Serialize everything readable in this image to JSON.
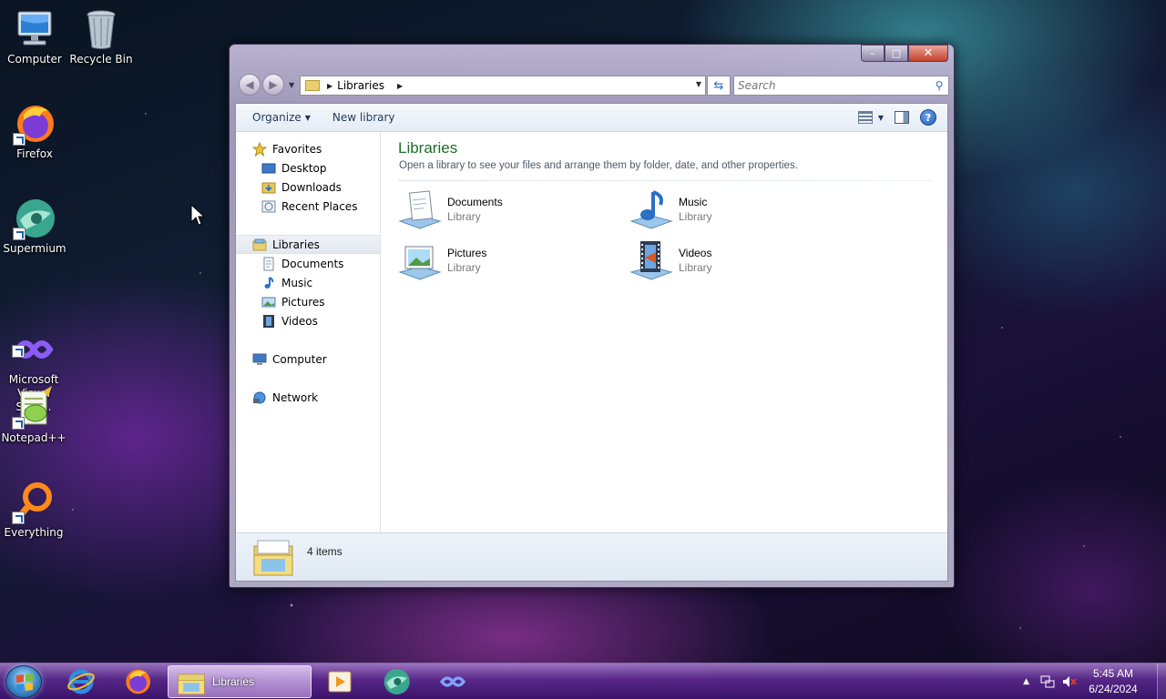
{
  "desktop": {
    "icons": [
      {
        "label": "Computer"
      },
      {
        "label": "Recycle Bin"
      },
      {
        "label": "Firefox"
      },
      {
        "label": "Supermium"
      },
      {
        "label": "Microsoft\nVisual Stud..."
      },
      {
        "label": "Notepad++"
      },
      {
        "label": "Everything"
      }
    ]
  },
  "window": {
    "caption": {
      "minimize": "–",
      "maximize": "□",
      "close": "✕"
    },
    "address": {
      "crumb": "Libraries"
    },
    "search": {
      "placeholder": "Search"
    },
    "toolbar": {
      "organize": "Organize",
      "new_library": "New library"
    },
    "nav": {
      "favorites": "Favorites",
      "desktop": "Desktop",
      "downloads": "Downloads",
      "recent_places": "Recent Places",
      "libraries": "Libraries",
      "documents": "Documents",
      "music": "Music",
      "pictures": "Pictures",
      "videos": "Videos",
      "computer": "Computer",
      "network": "Network"
    },
    "main": {
      "title": "Libraries",
      "subtitle": "Open a library to see your files and arrange them by folder, date, and other properties.",
      "items": [
        {
          "name": "Documents",
          "type": "Library"
        },
        {
          "name": "Music",
          "type": "Library"
        },
        {
          "name": "Pictures",
          "type": "Library"
        },
        {
          "name": "Videos",
          "type": "Library"
        }
      ]
    },
    "details": {
      "count": "4 items"
    }
  },
  "taskbar": {
    "active_task": "Libraries",
    "clock": {
      "time": "5:45 AM",
      "date": "6/24/2024"
    }
  }
}
